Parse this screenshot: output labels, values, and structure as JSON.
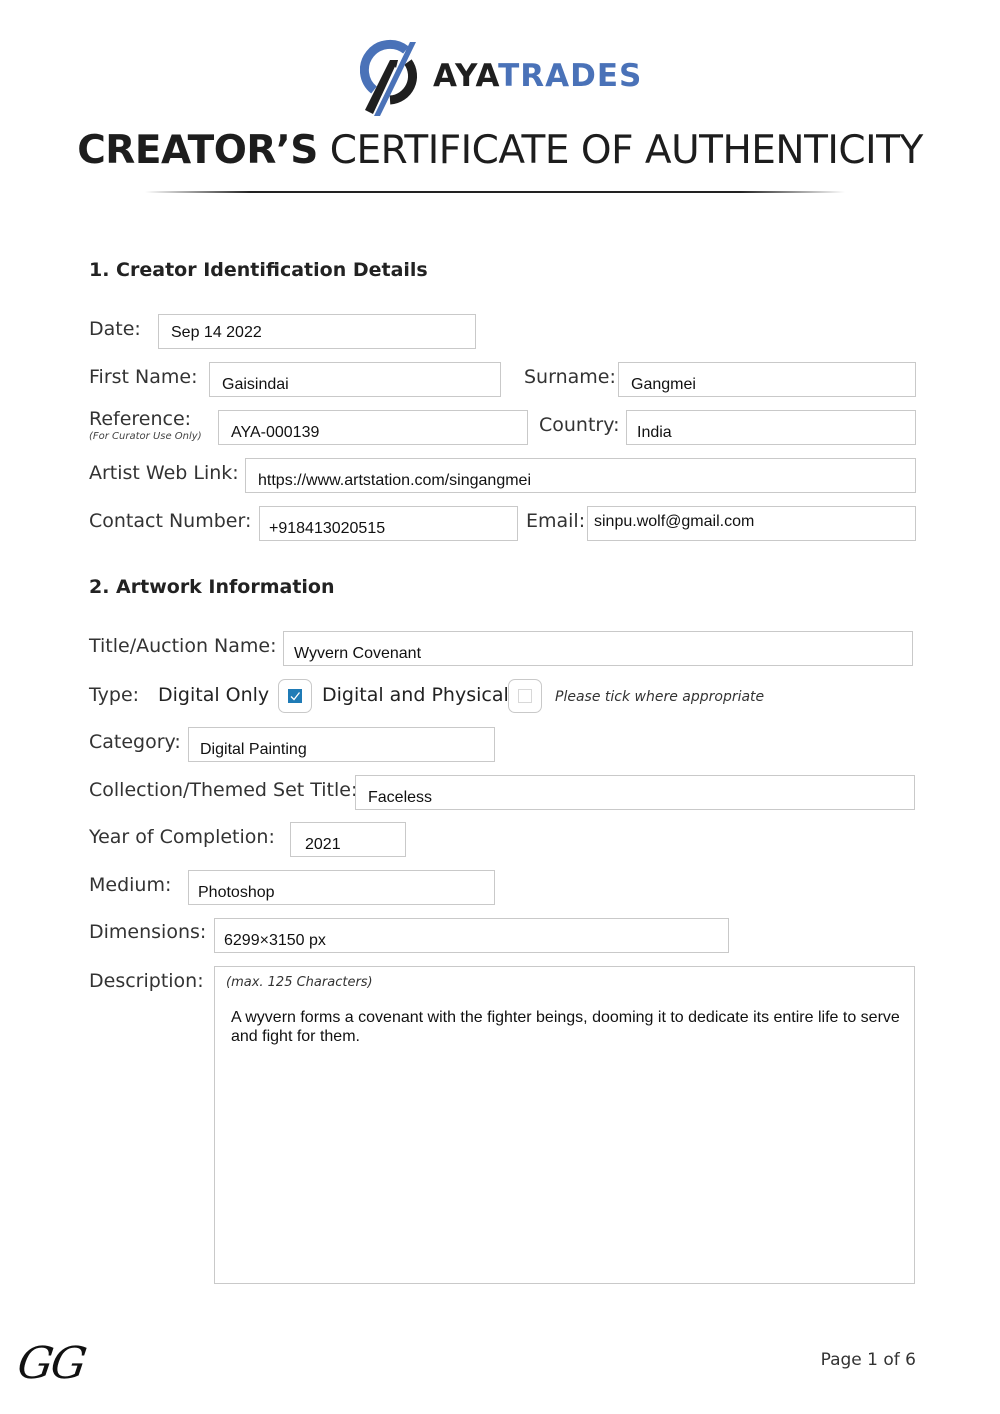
{
  "header": {
    "brand_part1": "AYA",
    "brand_part2": "TRADES",
    "title_bold": "CREATOR’S",
    "title_light": "CERTIFICATE OF AUTHENTICITY"
  },
  "section1": {
    "heading": "1. Creator Identification Details",
    "fields": {
      "date": {
        "label": "Date:",
        "value": "Sep 14 2022"
      },
      "first_name": {
        "label": "First Name:",
        "value": "Gaisindai"
      },
      "surname": {
        "label": "Surname:",
        "value": "Gangmei"
      },
      "reference": {
        "label": "Reference:",
        "sublabel": "(For Curator Use Only)",
        "value": "AYA-000139"
      },
      "country": {
        "label": "Country:",
        "value": "India"
      },
      "web_link": {
        "label": "Artist Web Link:",
        "value": "https://www.artstation.com/singangmei"
      },
      "contact": {
        "label": "Contact Number:",
        "value": "+918413020515"
      },
      "email": {
        "label": "Email:",
        "value": "sinpu.wolf@gmail.com"
      }
    }
  },
  "section2": {
    "heading": "2. Artwork Information",
    "fields": {
      "title": {
        "label": "Title/Auction Name:",
        "value": "Wyvern Covenant"
      },
      "type": {
        "label": "Type:",
        "options": [
          {
            "label": "Digital Only",
            "checked": true
          },
          {
            "label": "Digital and Physical",
            "checked": false
          }
        ],
        "note": "Please tick where appropriate"
      },
      "category": {
        "label": "Category:",
        "value": "Digital Painting"
      },
      "collection": {
        "label": "Collection/Themed Set Title:",
        "value": "Faceless"
      },
      "year": {
        "label": "Year of Completion:",
        "value": "2021"
      },
      "medium": {
        "label": "Medium:",
        "value": "Photoshop"
      },
      "dimensions": {
        "label": "Dimensions:",
        "value": "6299×3150 px"
      },
      "description": {
        "label": "Description:",
        "hint": "(max. 125 Characters)",
        "value": "A wyvern forms a covenant with the fighter beings, dooming it to dedicate its entire life to serve and fight for them."
      }
    }
  },
  "footer": {
    "signature": "GG",
    "page": "Page 1 of 6"
  },
  "colors": {
    "brand_blue": "#4a72b8",
    "checkbox_blue": "#1f7bb6",
    "field_border": "#c9c9c9"
  }
}
